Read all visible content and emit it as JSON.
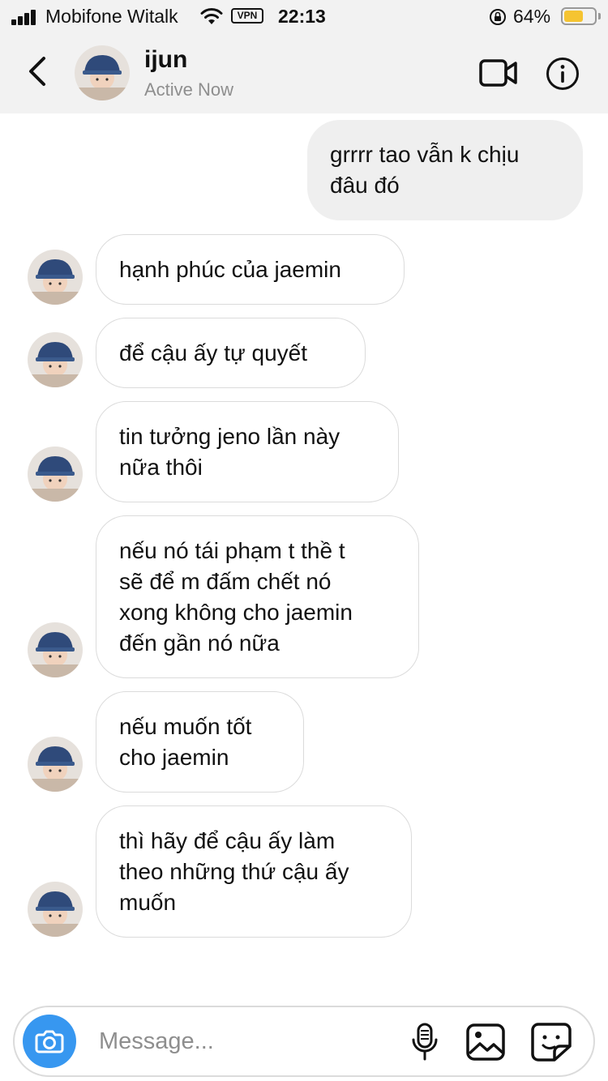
{
  "status_bar": {
    "carrier": "Mobifone Witalk",
    "vpn": "VPN",
    "time": "22:13",
    "battery_percent": "64%",
    "battery_level": 0.64,
    "battery_color": "#f5c431"
  },
  "header": {
    "name": "ijun",
    "status": "Active Now",
    "icons": [
      "chevron-left-icon",
      "video-camera-icon",
      "info-icon"
    ]
  },
  "messages": [
    {
      "direction": "outgoing",
      "lines": [
        "grrrr tao vẫn k chịu",
        "đâu đó"
      ]
    },
    {
      "direction": "incoming",
      "lines": [
        "hạnh phúc của jaemin"
      ]
    },
    {
      "direction": "incoming",
      "lines": [
        "để cậu ấy tự quyết"
      ]
    },
    {
      "direction": "incoming",
      "lines": [
        "tin tưởng jeno lần này",
        "nữa thôi"
      ]
    },
    {
      "direction": "incoming",
      "lines": [
        "nếu nó tái phạm t thề t",
        "sẽ để m đấm chết nó",
        "xong không cho jaemin",
        "đến gần nó nữa"
      ]
    },
    {
      "direction": "incoming",
      "lines": [
        "nếu muốn tốt",
        "cho jaemin"
      ]
    },
    {
      "direction": "incoming",
      "lines": [
        "thì hãy để cậu ấy làm",
        "theo những thứ cậu ấy",
        "muốn"
      ]
    }
  ],
  "composer": {
    "placeholder": "Message...",
    "icons": [
      "camera-icon",
      "microphone-icon",
      "gallery-icon",
      "sticker-icon"
    ],
    "accent_color": "#3797f0"
  }
}
